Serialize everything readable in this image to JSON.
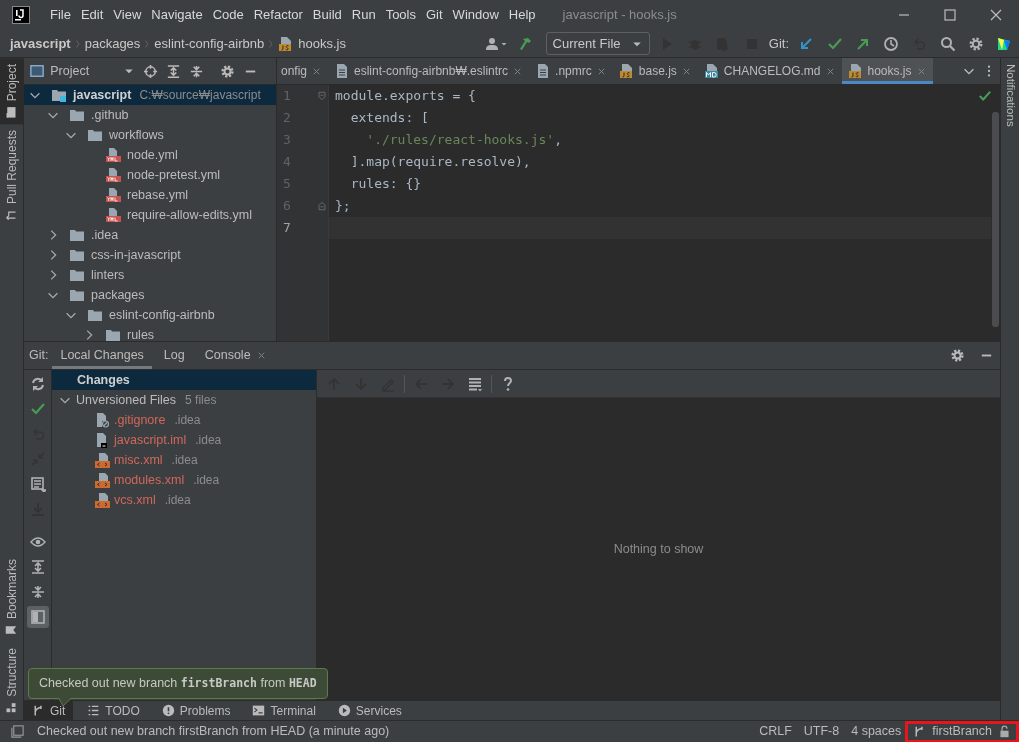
{
  "window": {
    "title": "javascript - hooks.js"
  },
  "menu": [
    "File",
    "Edit",
    "View",
    "Navigate",
    "Code",
    "Refactor",
    "Build",
    "Run",
    "Tools",
    "Git",
    "Window",
    "Help"
  ],
  "breadcrumb": [
    "javascript",
    "packages",
    "eslint-config-airbnb",
    "hooks.js"
  ],
  "toolbar": {
    "run_config": "Current File",
    "git_label": "Git:",
    "actions": [
      {
        "kind": "user",
        "disabled": false
      },
      {
        "kind": "hammer",
        "disabled": false
      },
      {
        "kind": "config"
      },
      {
        "kind": "run",
        "disabled": true
      },
      {
        "kind": "debug",
        "disabled": true
      },
      {
        "kind": "coverage",
        "disabled": true
      },
      {
        "kind": "stop",
        "disabled": true
      },
      {
        "kind": "git"
      },
      {
        "kind": "update",
        "disabled": false
      },
      {
        "kind": "commit",
        "disabled": false
      },
      {
        "kind": "push",
        "disabled": false
      },
      {
        "kind": "history",
        "disabled": false
      },
      {
        "kind": "rollback",
        "disabled": true
      },
      {
        "kind": "search",
        "disabled": false
      },
      {
        "kind": "settings",
        "disabled": false
      },
      {
        "kind": "logo",
        "disabled": false
      }
    ]
  },
  "left_stripe": {
    "top": [
      {
        "label": "Project",
        "selected": true
      },
      {
        "label": "Pull Requests",
        "selected": false
      }
    ],
    "bottom": [
      {
        "label": "Bookmarks",
        "selected": false
      },
      {
        "label": "Structure",
        "selected": false
      }
    ]
  },
  "right_stripe": [
    {
      "label": "Notifications",
      "selected": false
    }
  ],
  "project": {
    "title": "Project",
    "tree": [
      {
        "label": "javascript",
        "hint": "C:₩source₩javascript",
        "kind": "module",
        "expanded": true,
        "selected": true,
        "children": [
          {
            "label": ".github",
            "kind": "folder",
            "expanded": true,
            "selected": false,
            "children": [
              {
                "label": "workflows",
                "kind": "folder",
                "expanded": true,
                "selected": false,
                "children": [
                  {
                    "label": "node.yml",
                    "kind": "yml",
                    "selected": false
                  },
                  {
                    "label": "node-pretest.yml",
                    "kind": "yml",
                    "selected": false
                  },
                  {
                    "label": "rebase.yml",
                    "kind": "yml",
                    "selected": false
                  },
                  {
                    "label": "require-allow-edits.yml",
                    "kind": "yml",
                    "selected": false
                  }
                ]
              }
            ]
          },
          {
            "label": ".idea",
            "kind": "folder",
            "expanded": false,
            "selected": false
          },
          {
            "label": "css-in-javascript",
            "kind": "folder",
            "expanded": false,
            "selected": false
          },
          {
            "label": "linters",
            "kind": "folder",
            "expanded": false,
            "selected": false
          },
          {
            "label": "packages",
            "kind": "folder",
            "expanded": true,
            "selected": false,
            "children": [
              {
                "label": "eslint-config-airbnb",
                "kind": "folder",
                "expanded": true,
                "selected": false,
                "children": [
                  {
                    "label": "rules",
                    "kind": "folder",
                    "expanded": false,
                    "selected": false
                  }
                ]
              }
            ]
          }
        ]
      }
    ]
  },
  "editor": {
    "tabs": [
      {
        "label": "onfig",
        "kind": "none",
        "selected": false
      },
      {
        "label": "eslint-config-airbnb₩.eslintrc",
        "kind": "text",
        "selected": false
      },
      {
        "label": ".npmrc",
        "kind": "text",
        "selected": false
      },
      {
        "label": "base.js",
        "kind": "js",
        "selected": false
      },
      {
        "label": "CHANGELOG.md",
        "kind": "md",
        "selected": false
      },
      {
        "label": "hooks.js",
        "kind": "js",
        "selected": true
      }
    ],
    "lines": [
      {
        "number": "1",
        "current": false,
        "fold_start": true,
        "fold_end": false,
        "tokens": [
          {
            "text": "module.exports = {",
            "kind": "plain"
          }
        ]
      },
      {
        "number": "2",
        "current": false,
        "fold_start": false,
        "fold_end": false,
        "tokens": [
          {
            "text": "  extends: [",
            "kind": "plain"
          }
        ]
      },
      {
        "number": "3",
        "current": false,
        "fold_start": false,
        "fold_end": false,
        "tokens": [
          {
            "text": "    './rules/react-hooks.js'",
            "kind": "string"
          },
          {
            "text": ",",
            "kind": "plain"
          }
        ]
      },
      {
        "number": "4",
        "current": false,
        "fold_start": false,
        "fold_end": false,
        "tokens": [
          {
            "text": "  ].map(require.resolve),",
            "kind": "plain"
          }
        ]
      },
      {
        "number": "5",
        "current": false,
        "fold_start": false,
        "fold_end": false,
        "tokens": [
          {
            "text": "  rules: {}",
            "kind": "plain"
          }
        ]
      },
      {
        "number": "6",
        "current": false,
        "fold_start": false,
        "fold_end": true,
        "tokens": [
          {
            "text": "};",
            "kind": "plain"
          }
        ]
      },
      {
        "number": "7",
        "current": true,
        "fold_start": false,
        "fold_end": false
      }
    ]
  },
  "git_panel": {
    "label": "Git:",
    "tabs": [
      {
        "label": "Local Changes",
        "selected": true,
        "closable": false
      },
      {
        "label": "Log",
        "selected": false,
        "closable": false
      },
      {
        "label": "Console",
        "selected": false,
        "closable": true
      }
    ],
    "side_actions": [
      {
        "kind": "refresh",
        "disabled": false,
        "on": false
      },
      {
        "kind": "commit",
        "disabled": false,
        "on": false
      },
      {
        "kind": "rollback",
        "disabled": true,
        "on": false
      },
      {
        "kind": "merge",
        "disabled": true,
        "on": false
      },
      {
        "kind": "message",
        "disabled": false,
        "on": false
      },
      {
        "kind": "download",
        "disabled": true,
        "on": false
      },
      {
        "kind": "eye",
        "disabled": false,
        "on": false
      },
      {
        "kind": "expand",
        "disabled": false,
        "on": false
      },
      {
        "kind": "collapse",
        "disabled": false,
        "on": false
      },
      {
        "kind": "preview",
        "disabled": false,
        "on": true
      }
    ],
    "changes": {
      "title": "Changes",
      "selected": true,
      "group": {
        "label": "Unversioned Files",
        "count": "5 files",
        "expanded": true,
        "files": [
          {
            "name": ".gitignore",
            "dir": ".idea",
            "kind": "ignore"
          },
          {
            "name": "javascript.iml",
            "dir": ".idea",
            "kind": "iml"
          },
          {
            "name": "misc.xml",
            "dir": ".idea",
            "kind": "xml"
          },
          {
            "name": "modules.xml",
            "dir": ".idea",
            "kind": "xml"
          },
          {
            "name": "vcs.xml",
            "dir": ".idea",
            "kind": "xml"
          }
        ]
      }
    },
    "diff_actions": [
      {
        "kind": "up",
        "disabled": true
      },
      {
        "kind": "down",
        "disabled": true
      },
      {
        "kind": "edit",
        "disabled": true
      },
      {
        "kind": "sep"
      },
      {
        "kind": "left",
        "disabled": true
      },
      {
        "kind": "right",
        "disabled": true
      },
      {
        "kind": "lines",
        "disabled": false
      },
      {
        "kind": "sep"
      },
      {
        "kind": "help",
        "disabled": false
      }
    ],
    "empty_text": "Nothing to show"
  },
  "balloon": {
    "parts": [
      {
        "text": "Checked out new branch ",
        "kind": "plain"
      },
      {
        "text": "firstBranch",
        "kind": "code"
      },
      {
        "text": " from ",
        "kind": "plain"
      },
      {
        "text": "HEAD",
        "kind": "code"
      }
    ]
  },
  "tool_windows": [
    {
      "label": "Git",
      "kind": "git",
      "selected": true
    },
    {
      "label": "TODO",
      "kind": "todo",
      "selected": false
    },
    {
      "label": "Problems",
      "kind": "problems",
      "selected": false
    },
    {
      "label": "Terminal",
      "kind": "terminal",
      "selected": false
    },
    {
      "label": "Services",
      "kind": "services",
      "selected": false
    }
  ],
  "status_bar": {
    "message": "Checked out new branch firstBranch from HEAD (a minute ago)",
    "items": [
      "CRLF",
      "UTF-8",
      "4 spaces"
    ],
    "branch": "firstBranch",
    "branch_highlighted": true
  }
}
